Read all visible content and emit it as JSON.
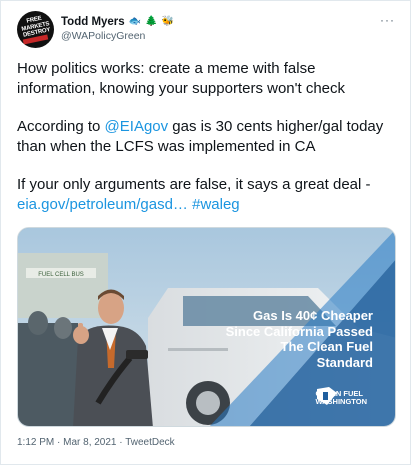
{
  "tweet": {
    "display_name": "Todd Myers",
    "name_emojis": [
      "🐟",
      "🌲",
      "🐝"
    ],
    "handle": "@WAPolicyGreen",
    "more_icon": "more-horizontal-icon",
    "avatar_text": "FREE MARKETS DESTROY",
    "text": {
      "line1": "How politics works: create a meme with false information, knowing your supporters won't check",
      "line2_prefix": "According to ",
      "line2_mention": "@EIAgov",
      "line2_suffix": " gas is 30 cents higher/gal today than when the LCFS was implemented in CA",
      "line3_prefix": "If your only arguments are false, it says a great deal - ",
      "line3_link": "eia.gov/petroleum/gasd…",
      "line3_space": " ",
      "line3_hashtag": "#waleg"
    },
    "media": {
      "sign_text": "FUEL CELL BUS",
      "headline": "Gas Is 40¢ Cheaper Since California Passed The Clean Fuel Standard",
      "brand_line1": "CLEAN FUEL",
      "brand_line2": "WASHINGTON"
    },
    "timestamp": "1:12 PM · Mar 8, 2021 · TweetDeck"
  },
  "colors": {
    "link": "#1b95e0",
    "text": "#0f1419",
    "muted": "#536471",
    "overlay_blue": "#1f5f9e"
  }
}
